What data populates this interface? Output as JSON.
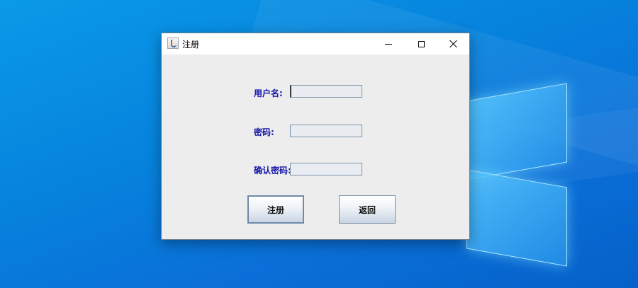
{
  "window": {
    "title": "注册",
    "controls": [
      "minimize-icon",
      "maximize-icon",
      "close-icon"
    ]
  },
  "form": {
    "username_label": "用户名:",
    "username_value": "",
    "password_label": "密码:",
    "password_value": "",
    "confirm_label": "确认密码:",
    "confirm_value": ""
  },
  "buttons": {
    "register": "注册",
    "back": "返回"
  },
  "colors": {
    "label": "#1515a8",
    "desktop": "#0683dd"
  }
}
